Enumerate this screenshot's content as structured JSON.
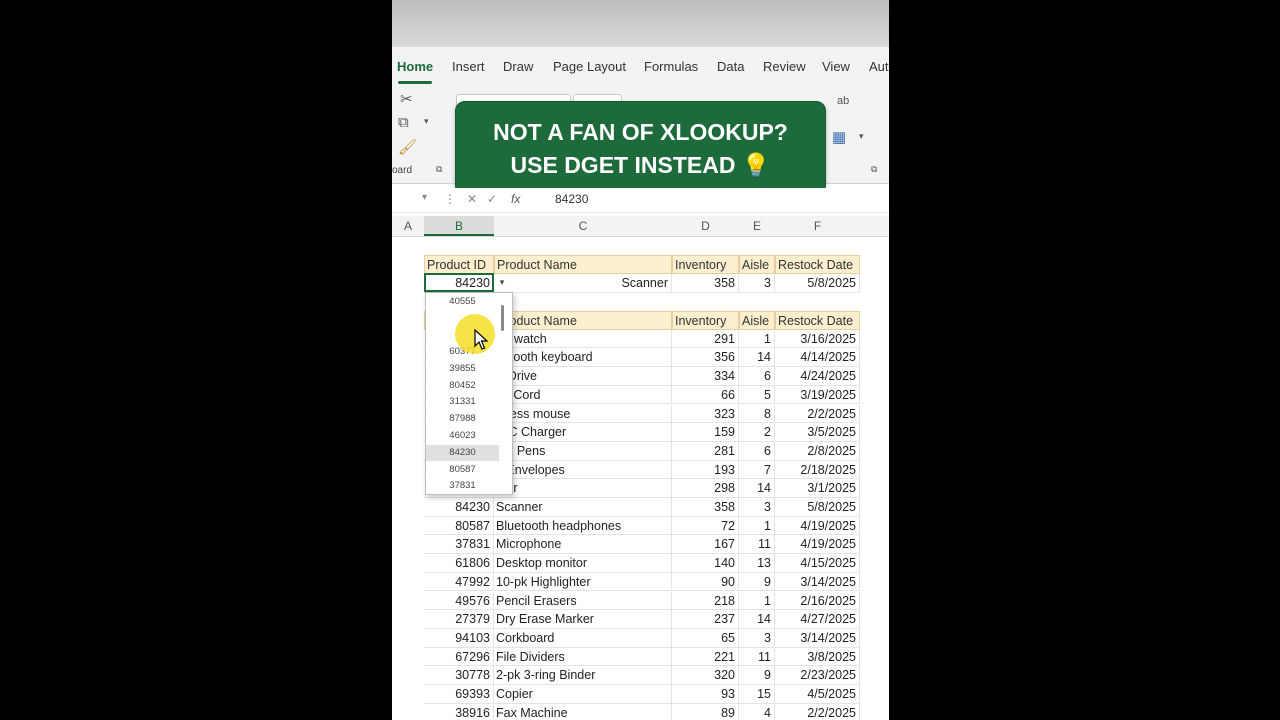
{
  "tabs": [
    "Home",
    "Insert",
    "Draw",
    "Page Layout",
    "Formulas",
    "Data",
    "Review",
    "View",
    "Aut"
  ],
  "ribbon": {
    "group_label": "oard"
  },
  "banner": {
    "line1": "NOT A FAN OF XLOOKUP?",
    "line2": "USE DGET INSTEAD 💡"
  },
  "formula_bar": {
    "fx": "fx",
    "value": "84230"
  },
  "columns": [
    "A",
    "B",
    "C",
    "D",
    "E",
    "F"
  ],
  "lookup": {
    "headers": [
      "Product ID",
      "Product Name",
      "Inventory",
      "Aisle",
      "Restock Date"
    ],
    "row": [
      "84230",
      "Scanner",
      "358",
      "3",
      "5/8/2025"
    ]
  },
  "dropdown": {
    "options": [
      "40555",
      "",
      "",
      "60377",
      "39855",
      "80452",
      "31331",
      "87988",
      "46023",
      "84230",
      "80587",
      "37831"
    ],
    "selected": "84230"
  },
  "table": {
    "headers": [
      "",
      "Product Name",
      "Inventory",
      "Aisle",
      "Restock Date"
    ],
    "rows": [
      [
        "",
        "art watch",
        "291",
        "1",
        "3/16/2025"
      ],
      [
        "",
        "uetooth keyboard",
        "356",
        "14",
        "4/14/2025"
      ],
      [
        "",
        "B Drive",
        "334",
        "6",
        "4/24/2025"
      ],
      [
        "",
        "MI Cord",
        "66",
        "5",
        "3/19/2025"
      ],
      [
        "",
        "reless mouse",
        "323",
        "8",
        "2/2/2025"
      ],
      [
        "",
        "B-C Charger",
        "159",
        "2",
        "3/5/2025"
      ],
      [
        "",
        "-pk Pens",
        "281",
        "6",
        "2/8/2025"
      ],
      [
        "",
        "0 Envelopes",
        "193",
        "7",
        "2/18/2025"
      ],
      [
        "",
        "nter",
        "298",
        "14",
        "3/1/2025"
      ],
      [
        "84230",
        "Scanner",
        "358",
        "3",
        "5/8/2025"
      ],
      [
        "80587",
        "Bluetooth headphones",
        "72",
        "1",
        "4/19/2025"
      ],
      [
        "37831",
        "Microphone",
        "167",
        "11",
        "4/19/2025"
      ],
      [
        "61806",
        "Desktop monitor",
        "140",
        "13",
        "4/15/2025"
      ],
      [
        "47992",
        "10-pk Highlighter",
        "90",
        "9",
        "3/14/2025"
      ],
      [
        "49576",
        "Pencil Erasers",
        "218",
        "1",
        "2/16/2025"
      ],
      [
        "27379",
        "Dry Erase Marker",
        "237",
        "14",
        "4/27/2025"
      ],
      [
        "94103",
        "Corkboard",
        "65",
        "3",
        "3/14/2025"
      ],
      [
        "67296",
        "File Dividers",
        "221",
        "11",
        "3/8/2025"
      ],
      [
        "30778",
        "2-pk 3-ring Binder",
        "320",
        "9",
        "2/23/2025"
      ],
      [
        "69393",
        "Copier",
        "93",
        "15",
        "4/5/2025"
      ],
      [
        "38916",
        "Fax Machine",
        "89",
        "4",
        "2/2/2025"
      ]
    ]
  },
  "colors": {
    "accent": "#1d6b3a",
    "header_fill": "#fcefd0",
    "highlight": "#f4de28"
  }
}
